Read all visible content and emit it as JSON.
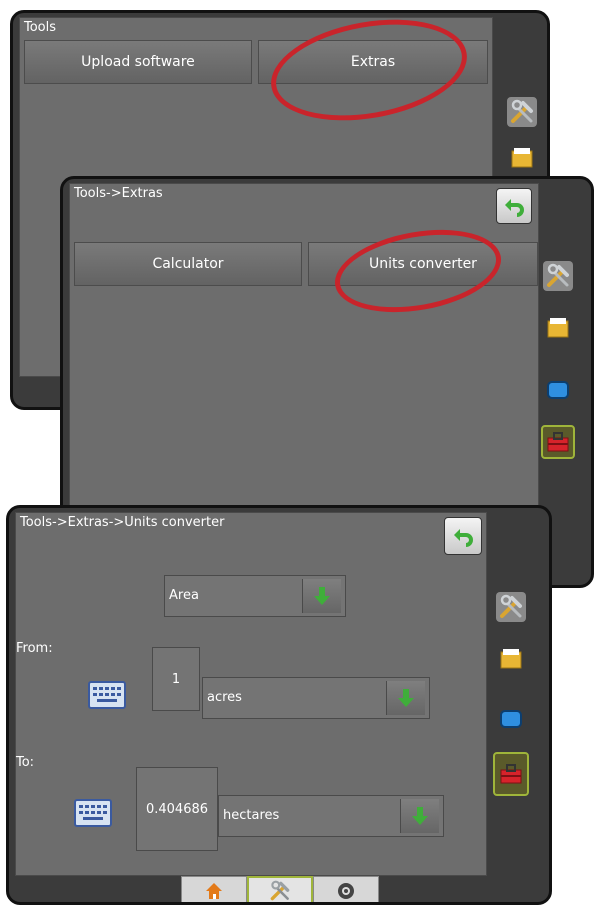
{
  "screen1": {
    "title": "Tools",
    "upload_label": "Upload software",
    "extras_label": "Extras"
  },
  "screen2": {
    "title": "Tools->Extras",
    "calculator_label": "Calculator",
    "units_converter_label": "Units converter"
  },
  "screen3": {
    "title": "Tools->Extras->Units converter",
    "category": "Area",
    "from_label": "From:",
    "from_value": "1",
    "from_unit": "acres",
    "to_label": "To:",
    "to_value": "0.404686",
    "to_unit": "hectares"
  },
  "sidebar_icons": [
    "tools-icon",
    "folder-icon",
    "display-icon",
    "toolbox-icon"
  ],
  "bottom_nav_icons": [
    "home-icon",
    "tools-icon",
    "camera-icon"
  ],
  "colors": {
    "panel": "#6d6d6d",
    "frame": "#3b3b3b",
    "highlight_ellipse": "#c9242b",
    "active_border": "#9fb53a",
    "arrow_green": "#3fae3a"
  }
}
